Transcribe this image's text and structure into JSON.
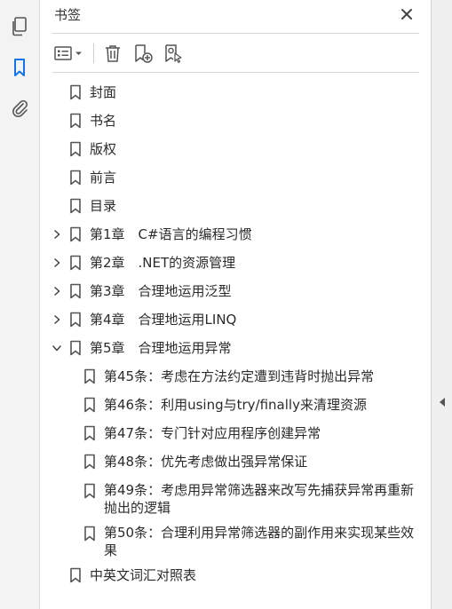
{
  "rail": {
    "icons": [
      "pages-icon",
      "bookmark-icon",
      "attachment-icon"
    ],
    "active": "bookmark-icon",
    "accent": "#1473e6"
  },
  "panel": {
    "title": "书签"
  },
  "toolbar": {
    "buttons": [
      "options-menu-icon",
      "delete-bookmark-icon",
      "new-bookmark-icon",
      "new-bookmark-from-selection-icon"
    ]
  },
  "tree": [
    {
      "label": "封面",
      "level": 0,
      "expander": "none"
    },
    {
      "label": "书名",
      "level": 0,
      "expander": "none"
    },
    {
      "label": "版权",
      "level": 0,
      "expander": "none"
    },
    {
      "label": "前言",
      "level": 0,
      "expander": "none"
    },
    {
      "label": "目录",
      "level": 0,
      "expander": "none"
    },
    {
      "label": "第1章　C#语言的编程习惯",
      "level": 0,
      "expander": "collapsed"
    },
    {
      "label": "第2章　.NET的资源管理",
      "level": 0,
      "expander": "collapsed"
    },
    {
      "label": "第3章　合理地运用泛型",
      "level": 0,
      "expander": "collapsed"
    },
    {
      "label": "第4章　合理地运用LINQ",
      "level": 0,
      "expander": "collapsed"
    },
    {
      "label": "第5章　合理地运用异常",
      "level": 0,
      "expander": "expanded"
    },
    {
      "label": "第45条：考虑在方法约定遭到违背时抛出异常",
      "level": 1,
      "expander": "none"
    },
    {
      "label": "第46条：利用using与try/finally来清理资源",
      "level": 1,
      "expander": "none"
    },
    {
      "label": "第47条：专门针对应用程序创建异常",
      "level": 1,
      "expander": "none"
    },
    {
      "label": "第48条：优先考虑做出强异常保证",
      "level": 1,
      "expander": "none"
    },
    {
      "label": "第49条：考虑用异常筛选器来改写先捕获异常再重新抛出的逻辑",
      "level": 1,
      "expander": "none",
      "wrap": true
    },
    {
      "label": "第50条：合理利用异常筛选器的副作用来实现某些效果",
      "level": 1,
      "expander": "none",
      "wrap": true
    },
    {
      "label": "中英文词汇对照表",
      "level": 0,
      "expander": "none"
    }
  ]
}
